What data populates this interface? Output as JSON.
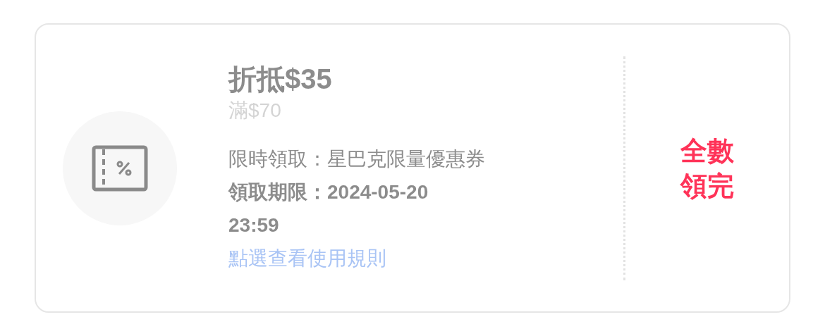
{
  "coupon": {
    "title": "折抵$35",
    "minimum": "滿$70",
    "details": [
      {
        "kind": "plain",
        "text": "限時領取：星巴克限量優惠券"
      },
      {
        "kind": "bold",
        "text": "領取期限：2024-05-20 23:59"
      }
    ],
    "rules_link": "點選查看使用規則",
    "status": "全數領完"
  }
}
